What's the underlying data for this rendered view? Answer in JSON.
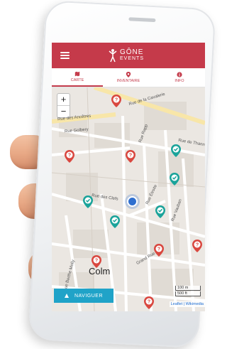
{
  "app": {
    "brand_main": "GÔNE",
    "brand_sub": "EVENTS"
  },
  "tabs": [
    {
      "label": "CARTE",
      "icon": "map-icon",
      "active": true
    },
    {
      "label": "INVENTAIRE",
      "icon": "pin-icon",
      "active": false
    },
    {
      "label": "INFO",
      "icon": "info-icon",
      "active": false
    }
  ],
  "map": {
    "zoom_in": "+",
    "zoom_out": "−",
    "city": "Colm",
    "streets": [
      "Rue de la Cavalerie",
      "Rue des Ancêtres",
      "Rue Golbery",
      "Rue de Thann",
      "Rue Rapp",
      "Rue Étroite",
      "Rue des Clefs",
      "Rue Vauban",
      "Grand Rue",
      "Rue Berthe Molly"
    ],
    "scale_m": "100 m",
    "scale_ft": "500 ft",
    "attribution": "Leaflet | Wikimedia"
  },
  "navigate_button": "NAVIGUER",
  "colors": {
    "brand_red": "#c53a4a",
    "marker_red": "#d9473f",
    "marker_teal": "#1aa39a",
    "nav_blue": "#20a3c8"
  }
}
